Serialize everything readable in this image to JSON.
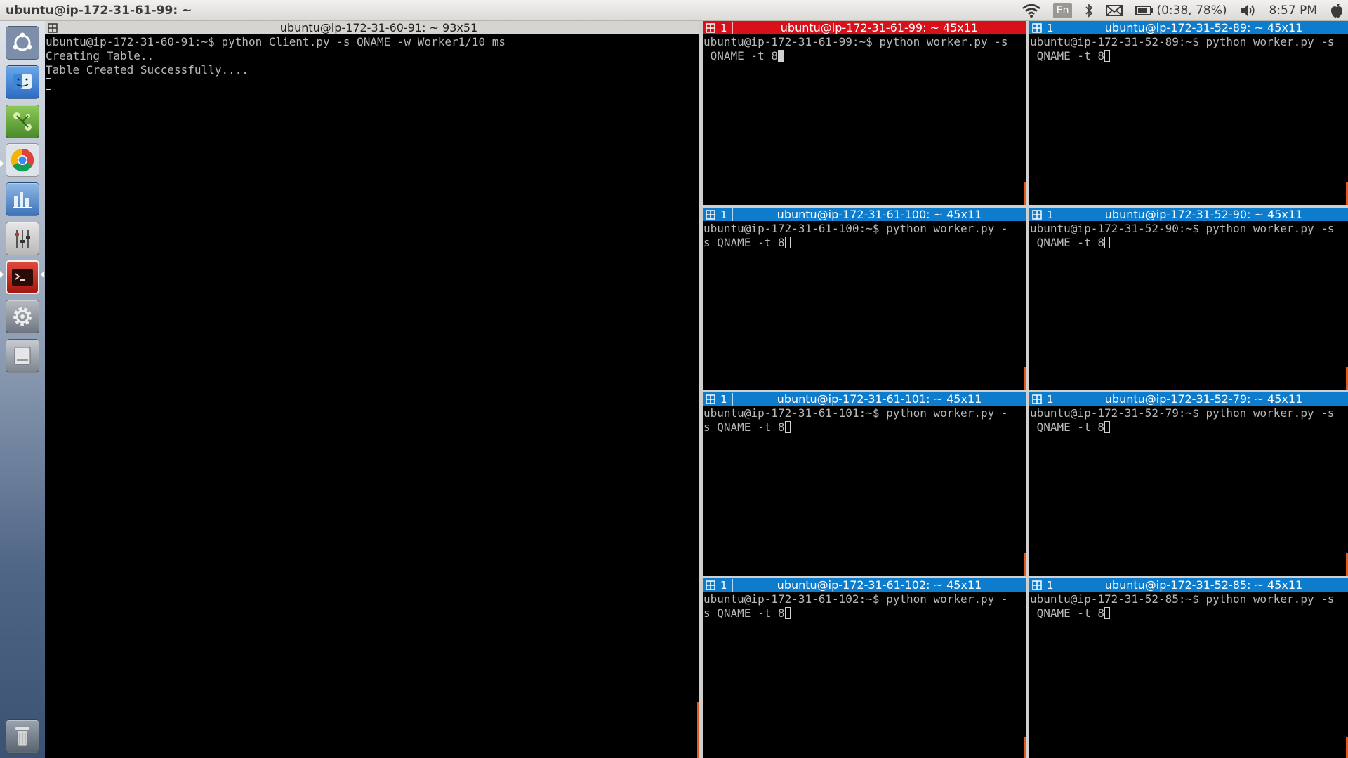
{
  "topbar": {
    "title": "ubuntu@ip-172-31-61-99: ~",
    "lang": "En",
    "battery": "(0:38, 78%)",
    "clock": "8:57 PM"
  },
  "launcher": {
    "items": [
      "ubuntu-dash-icon",
      "finder-icon",
      "network-icon",
      "chrome-icon",
      "charts-icon",
      "mixer-icon",
      "terminal-icon",
      "settings-icon",
      "drive-icon",
      "trash-icon"
    ]
  },
  "main_terminal": {
    "title": "ubuntu@ip-172-31-60-91: ~ 93x51",
    "lines": [
      "ubuntu@ip-172-31-60-91:~$ python Client.py -s QNAME -w Worker1/10_ms",
      "Creating Table..",
      "Table Created Successfully...."
    ]
  },
  "workers": [
    {
      "num": "1",
      "title": "ubuntu@ip-172-31-61-99: ~ 45x11",
      "line1": "ubuntu@ip-172-31-61-99:~$ python worker.py -s",
      "line2": " QNAME -t 8"
    },
    {
      "num": "1",
      "title": "ubuntu@ip-172-31-52-89: ~ 45x11",
      "line1": "ubuntu@ip-172-31-52-89:~$ python worker.py -s",
      "line2": " QNAME -t 8"
    },
    {
      "num": "1",
      "title": "ubuntu@ip-172-31-61-100: ~ 45x11",
      "line1": "ubuntu@ip-172-31-61-100:~$ python worker.py -",
      "line2": "s QNAME -t 8"
    },
    {
      "num": "1",
      "title": "ubuntu@ip-172-31-52-90: ~ 45x11",
      "line1": "ubuntu@ip-172-31-52-90:~$ python worker.py -s",
      "line2": " QNAME -t 8"
    },
    {
      "num": "1",
      "title": "ubuntu@ip-172-31-61-101: ~ 45x11",
      "line1": "ubuntu@ip-172-31-61-101:~$ python worker.py -",
      "line2": "s QNAME -t 8"
    },
    {
      "num": "1",
      "title": "ubuntu@ip-172-31-52-79: ~ 45x11",
      "line1": "ubuntu@ip-172-31-52-79:~$ python worker.py -s",
      "line2": " QNAME -t 8"
    },
    {
      "num": "1",
      "title": "ubuntu@ip-172-31-61-102: ~ 45x11",
      "line1": "ubuntu@ip-172-31-61-102:~$ python worker.py -",
      "line2": "s QNAME -t 8"
    },
    {
      "num": "1",
      "title": "ubuntu@ip-172-31-52-85: ~ 45x11",
      "line1": "ubuntu@ip-172-31-52-85:~$ python worker.py -s",
      "line2": " QNAME -t 8"
    }
  ],
  "colors": {
    "active_title": "#d7101a",
    "inactive_title": "#0d7ccc",
    "terminal_text": "#b8b8b8"
  }
}
